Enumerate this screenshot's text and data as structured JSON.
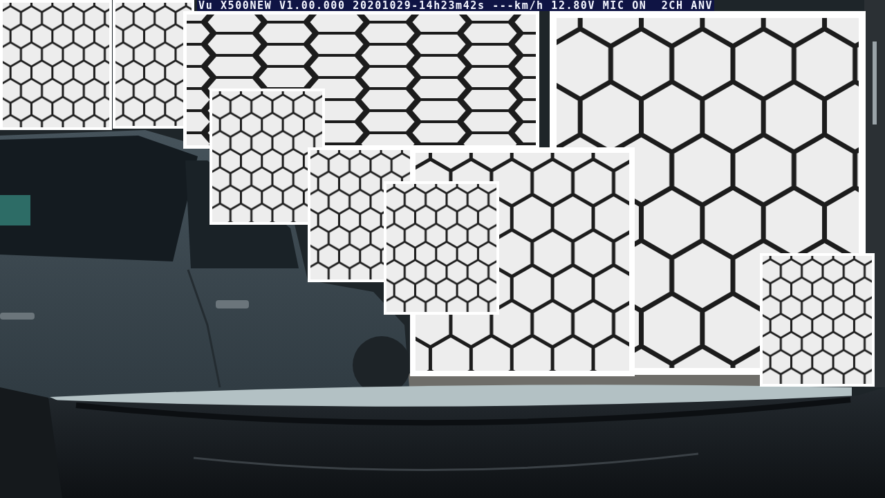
{
  "osd_stamp": "Vu X500NEW V1.00.000 20201029-14h23m42s ---km/h 12.80V MIC ON  2CH ANV",
  "tile_images": [
    {
      "kind": "small-hex"
    },
    {
      "kind": "small-hex"
    },
    {
      "kind": "long-hex"
    },
    {
      "kind": "large-hex"
    },
    {
      "kind": "small-hex"
    },
    {
      "kind": "small-hex"
    },
    {
      "kind": "medium-hex"
    },
    {
      "kind": "small-hex"
    },
    {
      "kind": "small-hex"
    }
  ]
}
